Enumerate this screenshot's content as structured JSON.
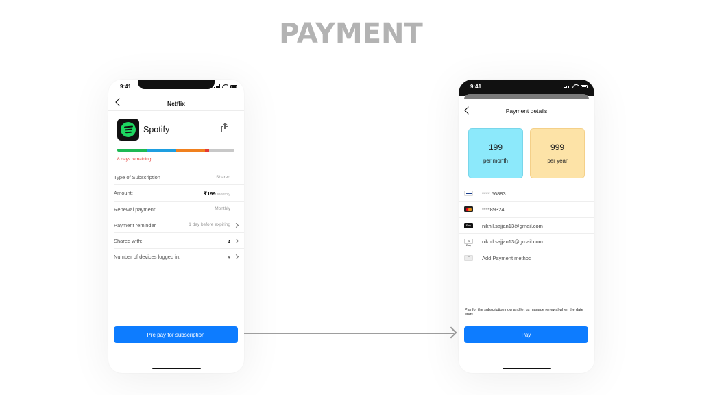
{
  "page": {
    "title": "PAYMENT"
  },
  "left_phone": {
    "status_time": "9:41",
    "header_title": "Netflix",
    "app": {
      "name": "Spotify",
      "logo_color": "#1ed760"
    },
    "progress": {
      "segments": [
        {
          "color": "#1db954",
          "fraction": 0.25
        },
        {
          "color": "#1e9ee0",
          "fraction": 0.25
        },
        {
          "color": "#f0801e",
          "fraction": 0.25
        },
        {
          "color": "#e53935",
          "fraction": 0.035
        },
        {
          "color": "#c8c8c8",
          "fraction": 0.215
        }
      ]
    },
    "days_remaining": "8 days remaining",
    "details": [
      {
        "label": "Type of Subscription",
        "value": "Shared"
      },
      {
        "label": "Amount:",
        "amount": "₹199",
        "amount_sub": "Monthly"
      },
      {
        "label": "Renewal payment:",
        "value": "Monthly"
      },
      {
        "label": "Payment reminder",
        "value": "1 day before expiring"
      },
      {
        "label": "Shared with:",
        "value": "4"
      },
      {
        "label": "Number of devices logged in:",
        "value": "5"
      }
    ],
    "prepay_button": "Pre pay for subscription"
  },
  "right_phone": {
    "status_time": "9:41",
    "header_title": "Payment details",
    "plans": [
      {
        "price": "199",
        "period": "per month",
        "color": "#8ce9fb",
        "border": "#79d6ea"
      },
      {
        "price": "999",
        "period": "per year",
        "color": "#fde3a7",
        "border": "#f4d089"
      }
    ],
    "payment_methods": [
      {
        "text": "**** 56883",
        "icon": "visa-card-icon",
        "icon_color": "#1a3e8c"
      },
      {
        "text": "****89324",
        "icon": "mastercard-icon",
        "icon_color": "#eb001b"
      },
      {
        "text": "nikhil.sajjan13@gmail.com",
        "icon": "apple-pay-icon",
        "icon_color": "#111111"
      },
      {
        "text": "nikhil.sajjan13@gmail.com",
        "icon": "google-pay-icon",
        "icon_color": "#ffffff"
      },
      {
        "text": "Add Payment method",
        "icon": "add-card-icon",
        "icon_color": "#e6e6e6"
      }
    ],
    "note": "Pay for the subscription now and let us manage renewal when the date ends",
    "pay_button": "Pay"
  },
  "colors": {
    "accent": "#0d7cff",
    "arrow": "#9e9e9e",
    "title": "#b3b3b3"
  }
}
